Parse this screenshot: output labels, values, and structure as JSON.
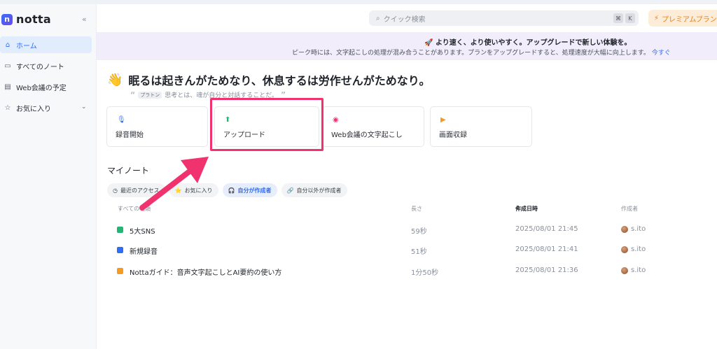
{
  "brand": {
    "logo_letter": "n",
    "name": "notta"
  },
  "sidebar": {
    "collapse_icon": "«",
    "items": [
      {
        "label": "ホーム",
        "icon": "home-icon",
        "active": true
      },
      {
        "label": "すべてのノート",
        "icon": "folder-icon"
      },
      {
        "label": "Web会議の予定",
        "icon": "calendar-icon"
      },
      {
        "label": "お気に入り",
        "icon": "star-icon"
      }
    ]
  },
  "header": {
    "search_placeholder": "クイック検索",
    "shortcut_keys": [
      "⌘",
      "K"
    ],
    "premium_label": "プレミアムプラン"
  },
  "banner": {
    "title": "より速く、より使いやすく。アップグレードで新しい体験を。",
    "subtitle": "ピーク時には、文字起こしの処理が混み合うことがあります。プランをアップグレードすると、処理速度が大幅に向上します。",
    "link": "今すぐ"
  },
  "greeting": {
    "title": "眠るは起きんがためなり、休息するは労作せんがためなり。",
    "quote_author": "プラトン",
    "quote_text": "思考とは、魂が自分と対話することだ。"
  },
  "actions": [
    {
      "label": "録音開始",
      "icon": "microphone-icon",
      "color": "#2f6df6"
    },
    {
      "label": "アップロード",
      "icon": "upload-icon",
      "color": "#22b573"
    },
    {
      "label": "Web会議の文字起こし",
      "icon": "meeting-icon",
      "color": "#f0336e"
    },
    {
      "label": "画面収録",
      "icon": "screen-record-icon",
      "color": "#f59a23"
    }
  ],
  "notes": {
    "section_title": "マイノート",
    "filters": [
      {
        "label": "最近のアクセス"
      },
      {
        "label": "お気に入り"
      },
      {
        "label": "自分が作成者",
        "active": true
      },
      {
        "label": "自分以外が作成者"
      }
    ],
    "columns": {
      "type": "すべての種類",
      "length": "長さ",
      "created": "作成日時",
      "creator": "作成者"
    },
    "rows": [
      {
        "name": "5大SNS",
        "length": "59秒",
        "created": "2025/08/01 21:45",
        "creator": "s.ito",
        "color": "#22b573"
      },
      {
        "name": "新規録音",
        "length": "51秒",
        "created": "2025/08/01 21:41",
        "creator": "s.ito",
        "color": "#2f6df6"
      },
      {
        "name": "Nottaガイド：音声文字起こしとAI要約の使い方",
        "length": "1分50秒",
        "created": "2025/08/01 21:36",
        "creator": "s.ito",
        "color": "#f59a23"
      }
    ]
  },
  "colors": {
    "accent": "#2f6df6",
    "highlight": "#f0336e"
  }
}
